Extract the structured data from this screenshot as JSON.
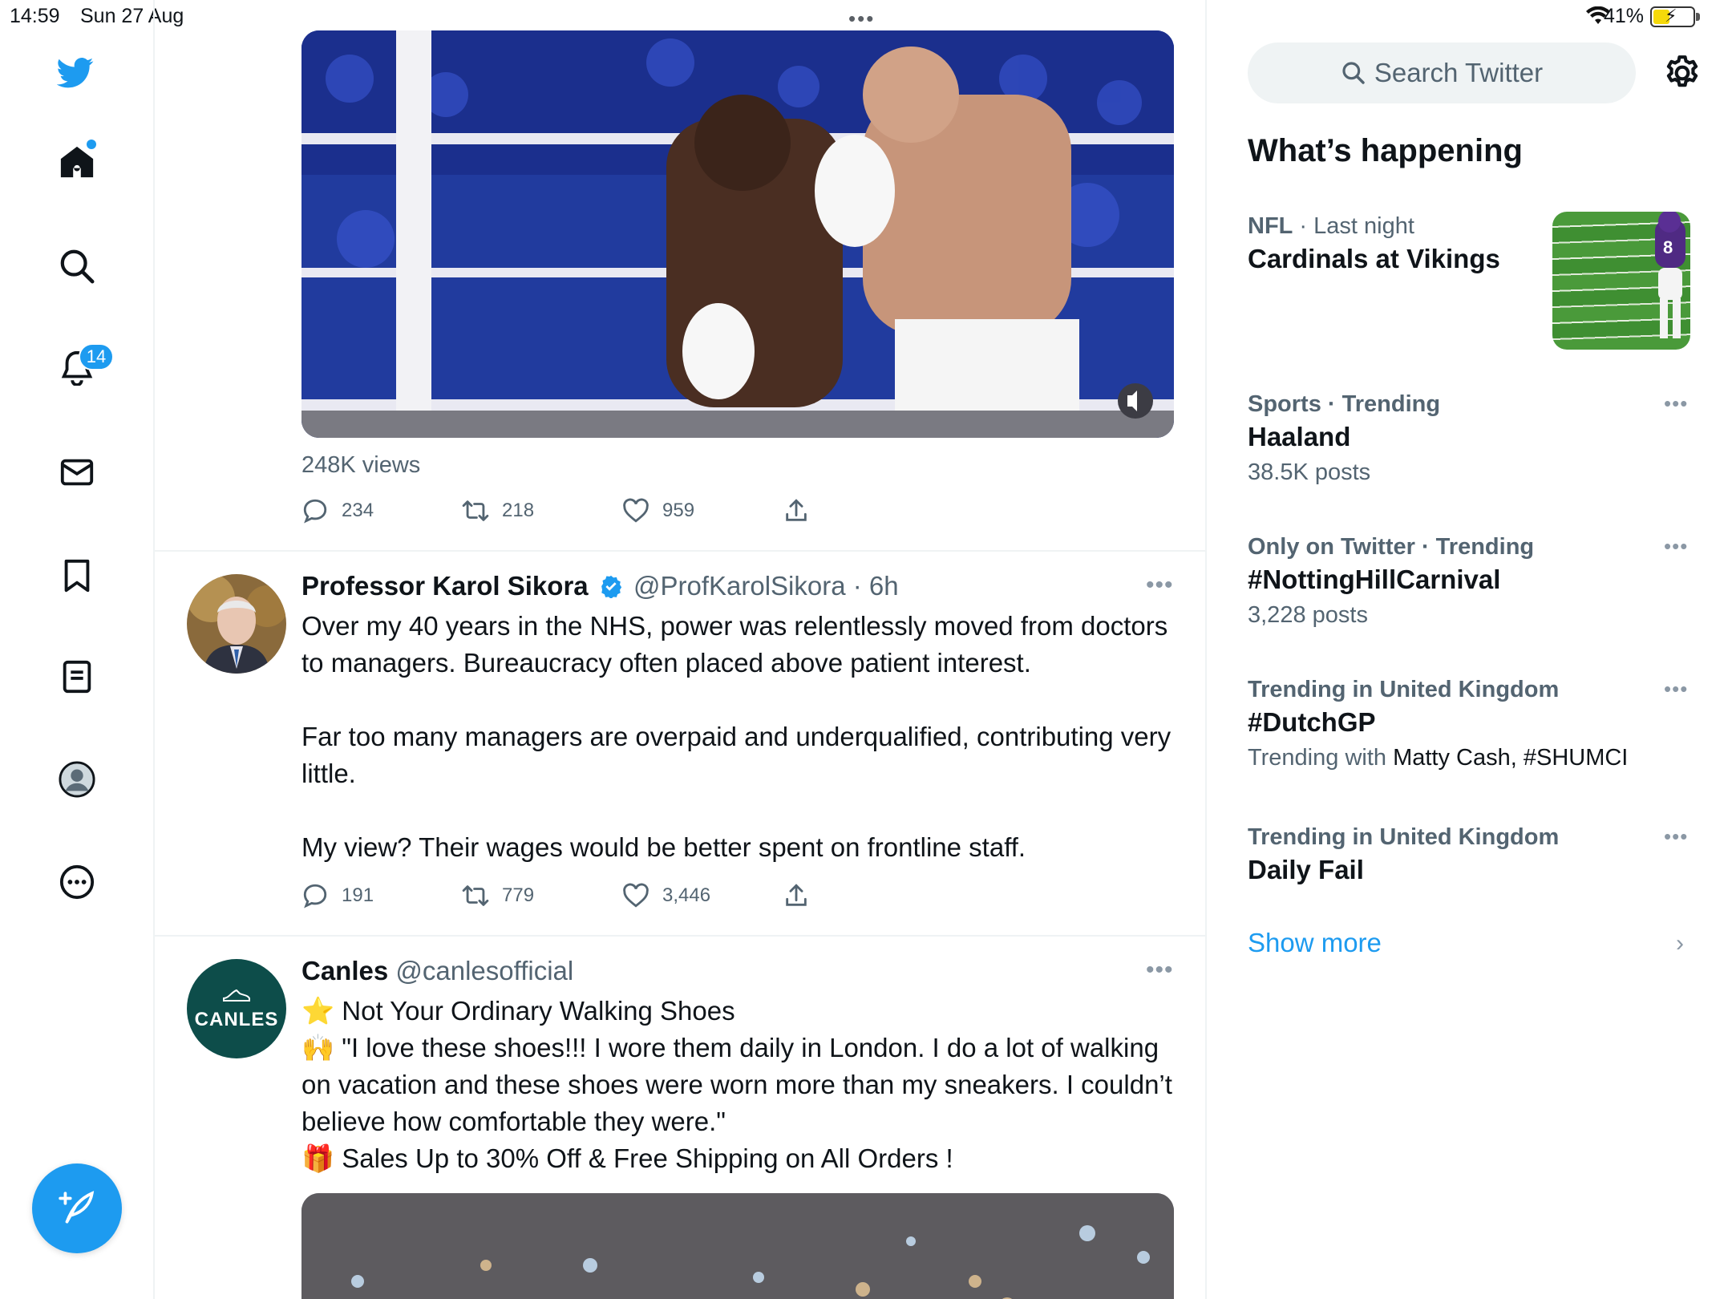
{
  "status_bar": {
    "time": "14:59",
    "date": "Sun 27 Aug",
    "battery": "41%",
    "multitask_dots": "•••"
  },
  "nav": {
    "notifications_badge": "14"
  },
  "tweets": [
    {
      "views": "248K views",
      "replies": "234",
      "retweets": "218",
      "likes": "959"
    },
    {
      "name": "Professor Karol Sikora",
      "handle": "@ProfKarolSikora",
      "time": "· 6h",
      "paragraphs": [
        "Over my 40 years in the NHS, power was relentlessly moved from doctors to managers. Bureaucracy often placed above patient interest.",
        "Far too many managers are overpaid and underqualified, contributing very little.",
        "My view? Their wages would be better spent on frontline staff."
      ],
      "replies": "191",
      "retweets": "779",
      "likes": "3,446"
    },
    {
      "name": "Canles",
      "handle": "@canlesofficial",
      "avatar_text": "CANLES",
      "lines": [
        "⭐ Not Your Ordinary Walking Shoes",
        "🙌 \"I love these shoes!!! I wore them daily in London. I do a lot of walking on vacation and these shoes were worn more than my sneakers. I couldn’t believe how comfortable they were.\"",
        "🎁 Sales Up to 30% Off & Free Shipping on All Orders !"
      ]
    }
  ],
  "sidebar": {
    "search_placeholder": "Search Twitter",
    "title": "What’s happening",
    "trends": [
      {
        "category": "NFL",
        "context": " · Last night",
        "title": "Cardinals at Vikings",
        "sub": ""
      },
      {
        "category": "Sports · Trending",
        "context": "",
        "title": "Haaland",
        "sub": "38.5K posts"
      },
      {
        "category": "Only on Twitter · Trending",
        "context": "",
        "title": "#NottingHillCarnival",
        "sub": "3,228 posts"
      },
      {
        "category": "Trending in United Kingdom",
        "context": "",
        "title": "#DutchGP",
        "sub_prefix": "Trending with ",
        "sub": "Matty Cash, #SHUMCI"
      },
      {
        "category": "Trending in United Kingdom",
        "context": "",
        "title": "Daily Fail",
        "sub": ""
      }
    ],
    "show_more": "Show more"
  },
  "colors": {
    "accent": "#1d9bf0",
    "text": "#0f1419",
    "secondary": "#536471",
    "canles_avatar": "#0d4d4a"
  },
  "icons": [
    "twitter-bird-icon",
    "home-icon",
    "search-icon",
    "bell-icon",
    "mail-icon",
    "bookmark-icon",
    "lists-icon",
    "profile-icon",
    "more-circle-icon",
    "compose-icon",
    "reply-icon",
    "retweet-icon",
    "like-icon",
    "share-icon",
    "gear-icon",
    "verified-icon",
    "chevron-right-icon"
  ]
}
